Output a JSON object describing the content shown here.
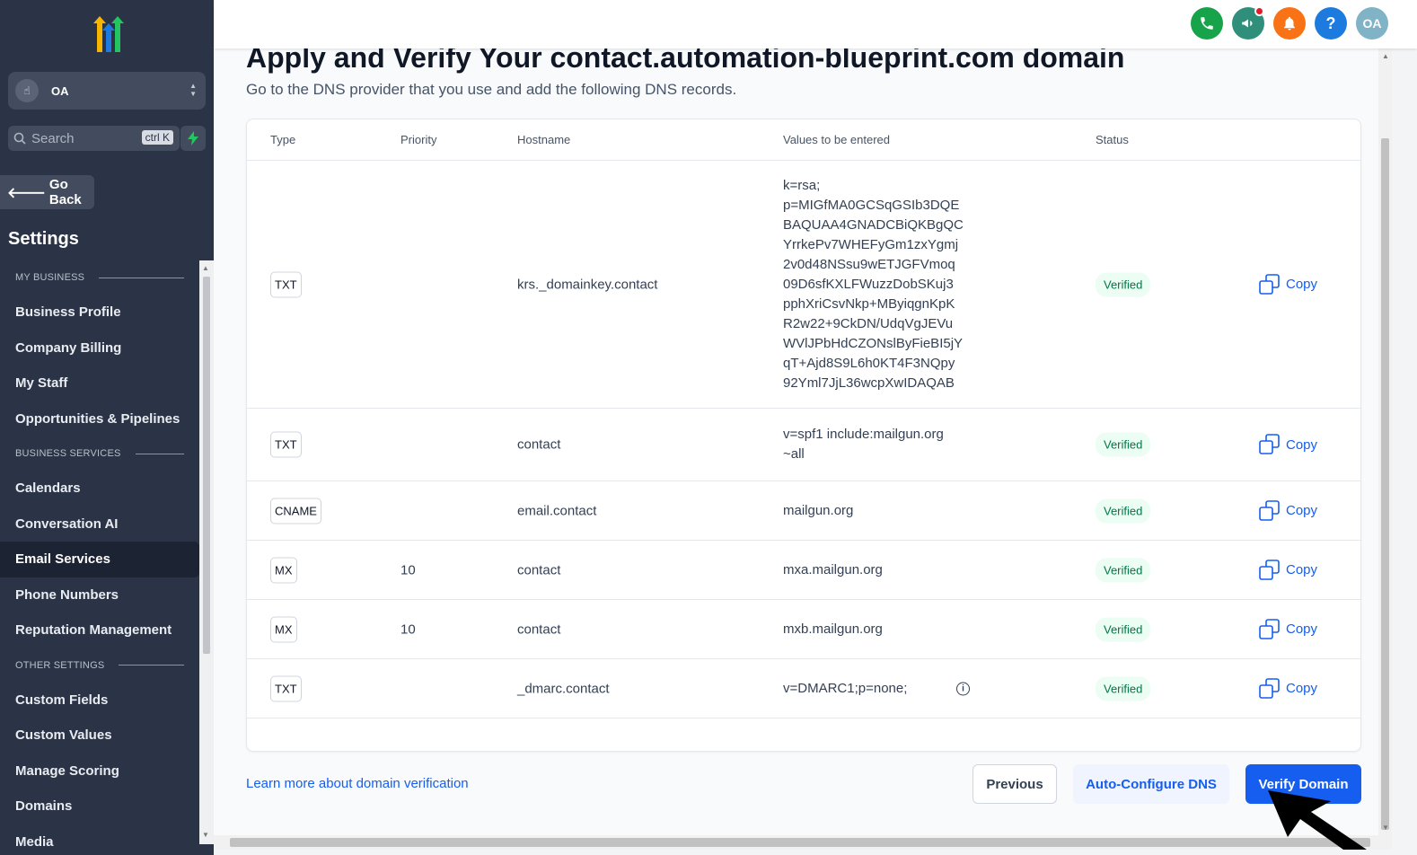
{
  "sidebar": {
    "account_initials": "OA",
    "search_placeholder": "Search",
    "search_shortcut": "ctrl K",
    "go_back": "Go Back",
    "title": "Settings",
    "sections": [
      {
        "label": "MY BUSINESS",
        "items": [
          "Business Profile",
          "Company Billing",
          "My Staff",
          "Opportunities & Pipelines"
        ]
      },
      {
        "label": "BUSINESS SERVICES",
        "items": [
          "Calendars",
          "Conversation AI",
          "Email Services",
          "Phone Numbers",
          "Reputation Management"
        ]
      },
      {
        "label": "OTHER SETTINGS",
        "items": [
          "Custom Fields",
          "Custom Values",
          "Manage Scoring",
          "Domains",
          "Media"
        ]
      }
    ],
    "active_item": "Email Services"
  },
  "header": {
    "avatar_initials": "OA",
    "colors": {
      "phone": "#16a34a",
      "announce": "#2f8f7a",
      "bell": "#f97316",
      "help": "#1d7be0",
      "avatar": "#7fb3c5"
    }
  },
  "main": {
    "title": "Apply and Verify Your contact.automation-blueprint.com domain",
    "subtitle": "Go to the DNS provider that you use and add the following DNS records.",
    "table": {
      "headers": {
        "type": "Type",
        "priority": "Priority",
        "hostname": "Hostname",
        "values": "Values to be entered",
        "status": "Status"
      },
      "rows": [
        {
          "type": "TXT",
          "priority": "",
          "hostname": "krs._domainkey.contact",
          "value": [
            "k=rsa;",
            "p=MIGfMA0GCSqGSIb3DQE",
            "BAQUAA4GNADCBiQKBgQC",
            "YrrkePv7WHEFyGm1zxYgmj",
            "2v0d48NSsu9wETJGFVmoq",
            "09D6sfKXLFWuzzDobSKuj3",
            "pphXriCsvNkp+MByiqgnKpK",
            "R2w22+9CkDN/UdqVgJEVu",
            "WVlJPbHdCZONslByFieBI5jY",
            "qT+Ajd8S9L6h0KT4F3NQpy",
            "92Yml7JjL36wcpXwIDAQAB"
          ],
          "status": "Verified",
          "action": "Copy"
        },
        {
          "type": "TXT",
          "priority": "",
          "hostname": "contact",
          "value": [
            "v=spf1 include:mailgun.org",
            "~all"
          ],
          "status": "Verified",
          "action": "Copy"
        },
        {
          "type": "CNAME",
          "priority": "",
          "hostname": "email.contact",
          "value": [
            "mailgun.org"
          ],
          "status": "Verified",
          "action": "Copy"
        },
        {
          "type": "MX",
          "priority": "10",
          "hostname": "contact",
          "value": [
            "mxa.mailgun.org"
          ],
          "status": "Verified",
          "action": "Copy"
        },
        {
          "type": "MX",
          "priority": "10",
          "hostname": "contact",
          "value": [
            "mxb.mailgun.org"
          ],
          "status": "Verified",
          "action": "Copy"
        },
        {
          "type": "TXT",
          "priority": "",
          "hostname": "_dmarc.contact",
          "value": [
            "v=DMARC1;p=none;"
          ],
          "status": "Verified",
          "action": "Copy",
          "info_icon": "info-icon"
        }
      ]
    },
    "learn_link": "Learn more about domain verification",
    "buttons": {
      "previous": "Previous",
      "auto_configure": "Auto-Configure DNS",
      "verify": "Verify Domain"
    }
  }
}
